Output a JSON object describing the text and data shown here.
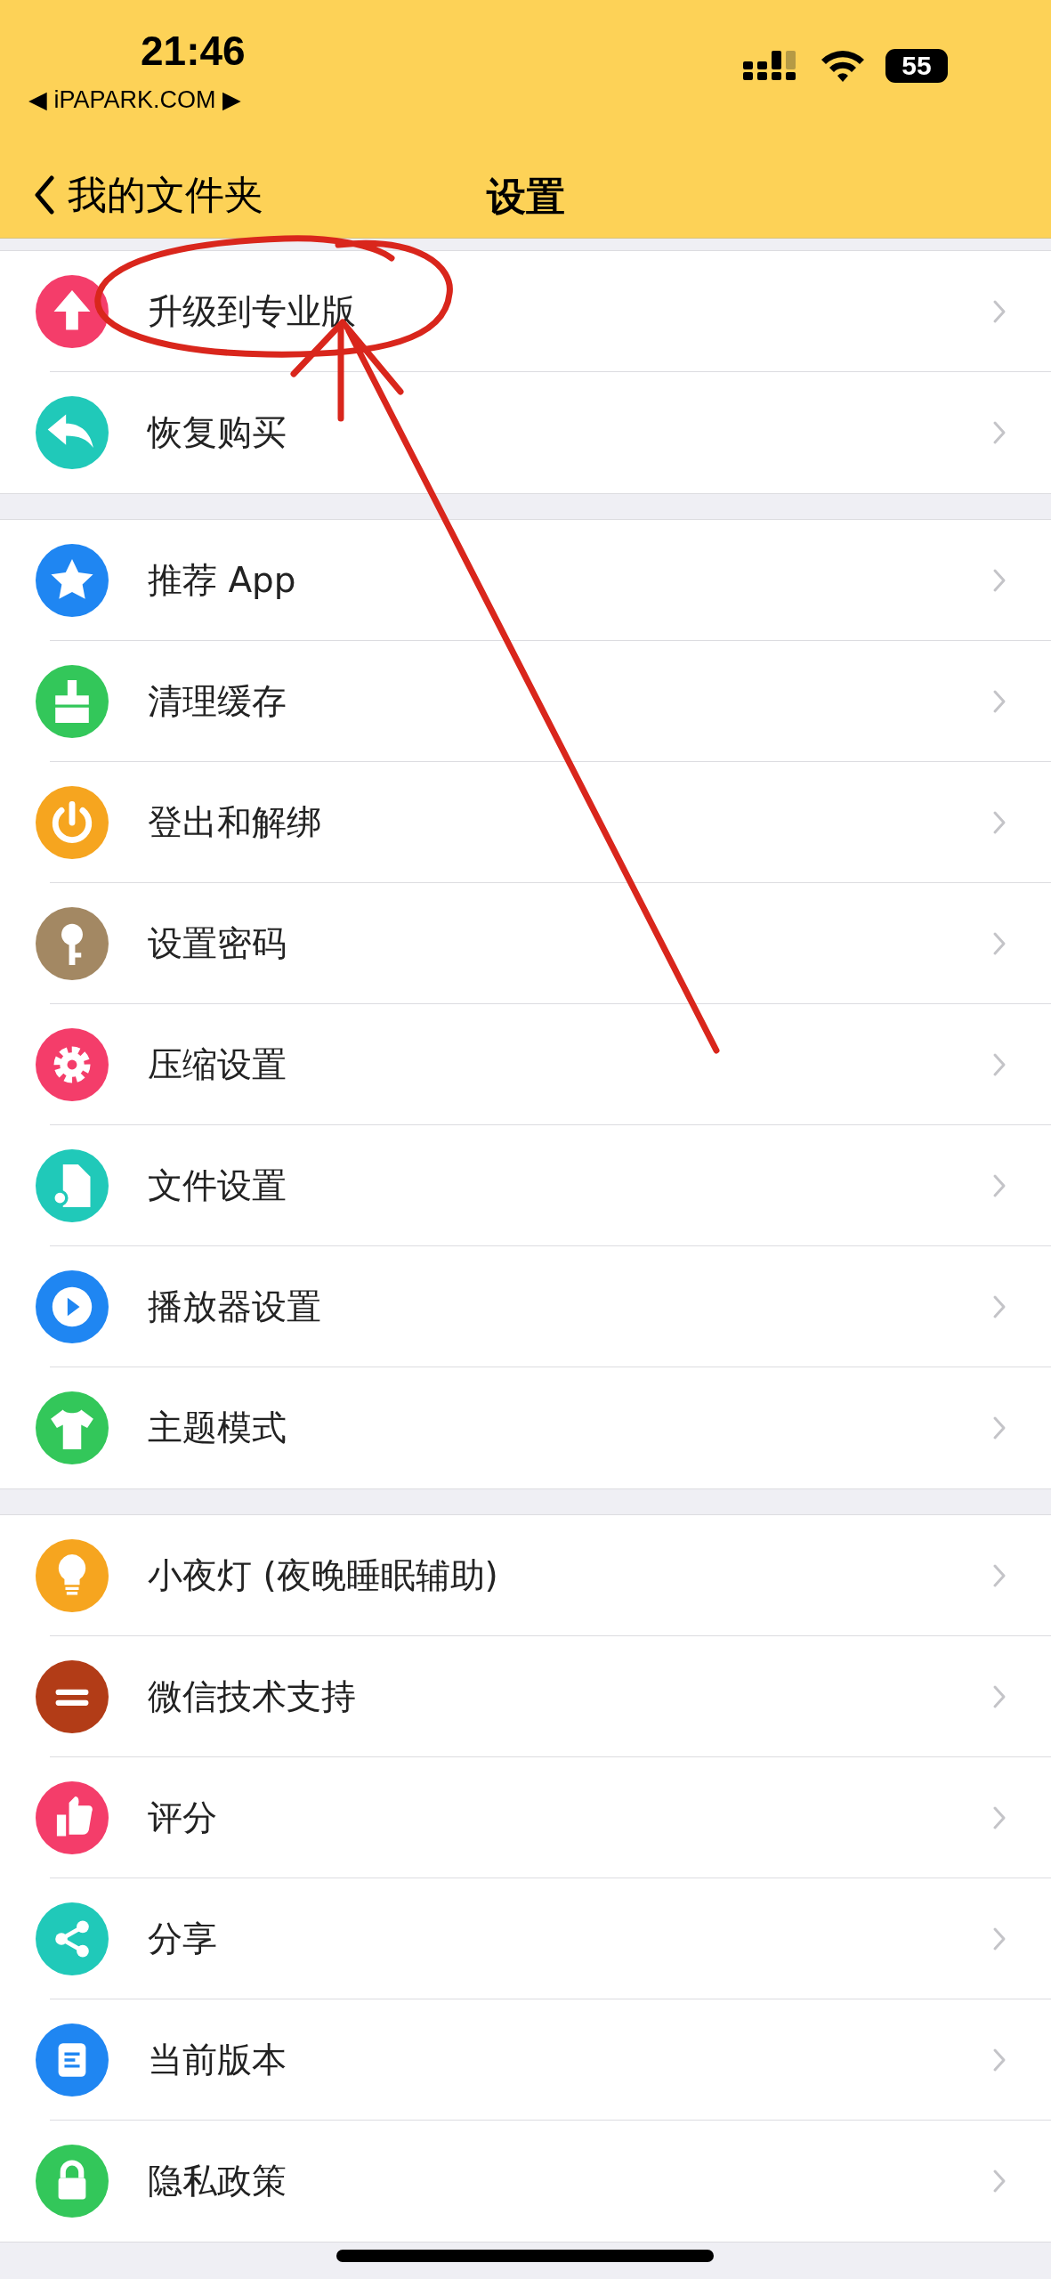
{
  "status_bar": {
    "time": "21:46",
    "back_app": "◀ iPAPARK.COM ▶",
    "battery": "55"
  },
  "nav_bar": {
    "back_label": "我的文件夹",
    "title": "设置"
  },
  "groups": [
    {
      "items": [
        {
          "label": "升级到专业版",
          "color": "#f43d6a"
        },
        {
          "label": "恢复购买",
          "color": "#20c9b9"
        }
      ]
    },
    {
      "items": [
        {
          "label": "推荐 App",
          "color": "#1f86f2"
        },
        {
          "label": "清理缓存",
          "color": "#33c75a"
        },
        {
          "label": "登出和解绑",
          "color": "#f6a51f"
        },
        {
          "label": "设置密码",
          "color": "#a38863"
        },
        {
          "label": "压缩设置",
          "color": "#f43d6a"
        },
        {
          "label": "文件设置",
          "color": "#20c9b9"
        },
        {
          "label": "播放器设置",
          "color": "#1f86f2"
        },
        {
          "label": "主题模式",
          "color": "#33c75a"
        }
      ]
    },
    {
      "items": [
        {
          "label": "小夜灯 (夜晚睡眠辅助)",
          "color": "#f6a51f"
        },
        {
          "label": "微信技术支持",
          "color": "#b23c17"
        },
        {
          "label": "评分",
          "color": "#f43d6a"
        },
        {
          "label": "分享",
          "color": "#20c9b9"
        },
        {
          "label": "当前版本",
          "color": "#1f86f2"
        },
        {
          "label": "隐私政策",
          "color": "#33c75a"
        }
      ]
    }
  ]
}
